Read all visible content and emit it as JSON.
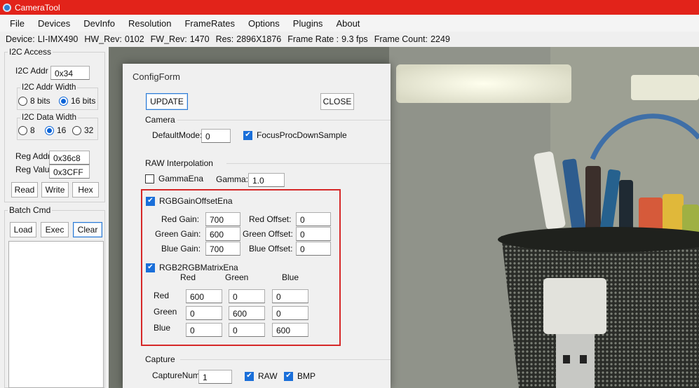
{
  "window": {
    "title": "CameraTool"
  },
  "menu": [
    "File",
    "Devices",
    "DevInfo",
    "Resolution",
    "FrameRates",
    "Options",
    "Plugins",
    "About"
  ],
  "device_info": {
    "device_label": "Device:",
    "device": "LI-IMX490",
    "hw_label": "HW_Rev:",
    "hw": "0102",
    "fw_label": "FW_Rev:",
    "fw": "1470",
    "res_label": "Res:",
    "res": "2896X1876",
    "fps_label": "Frame Rate :",
    "fps": "9.3 fps",
    "count_label": "Frame Count:",
    "count": "2249"
  },
  "i2c": {
    "group_label": "I2C Access",
    "addr_label": "I2C Addr",
    "addr_value": "0x34",
    "addr_width": {
      "label": "I2C Addr Width",
      "opt_8": "8 bits",
      "opt_16": "16 bits",
      "selected": "16 bits"
    },
    "data_width": {
      "label": "I2C Data Width",
      "opt_8": "8",
      "opt_16": "16",
      "opt_32": "32",
      "selected": "16"
    },
    "reg_addr_label": "Reg Addr",
    "reg_addr_value": "0x36c8",
    "reg_value_label": "Reg Value",
    "reg_value_value": "0x3CFF",
    "read_btn": "Read",
    "write_btn": "Write",
    "hex_btn": "Hex"
  },
  "batch": {
    "label": "Batch Cmd",
    "load_btn": "Load",
    "exec_btn": "Exec",
    "clear_btn": "Clear"
  },
  "config": {
    "title": "ConfigForm",
    "update_btn": "UPDATE",
    "close_btn": "CLOSE",
    "camera": {
      "label": "Camera",
      "default_mode_label": "DefaultMode:",
      "default_mode_value": "0",
      "focus_label": "FocusProcDownSample",
      "focus_checked": true
    },
    "raw": {
      "label": "RAW Interpolation",
      "gamma_ena_label": "GammaEna",
      "gamma_ena_checked": false,
      "gamma_label": "Gamma:",
      "gamma_value": "1.0",
      "gain_offset_label": "RGBGainOffsetEna",
      "gain_offset_checked": true,
      "red_gain_label": "Red Gain:",
      "red_gain": "700",
      "red_offset_label": "Red Offset:",
      "red_offset": "0",
      "green_gain_label": "Green Gain:",
      "green_gain": "600",
      "green_offset_label": "Green Offset:",
      "green_offset": "0",
      "blue_gain_label": "Blue Gain:",
      "blue_gain": "700",
      "blue_offset_label": "Blue Offset:",
      "blue_offset": "0",
      "matrix_label": "RGB2RGBMatrixEna",
      "matrix_checked": true,
      "matrix_cols": [
        "Red",
        "Green",
        "Blue"
      ],
      "matrix_rows": [
        {
          "label": "Red",
          "values": [
            "600",
            "0",
            "0"
          ]
        },
        {
          "label": "Green",
          "values": [
            "0",
            "600",
            "0"
          ]
        },
        {
          "label": "Blue",
          "values": [
            "0",
            "0",
            "600"
          ]
        }
      ]
    },
    "capture": {
      "label": "Capture",
      "num_label": "CaptureNum:",
      "num_value": "1",
      "raw_label": "RAW",
      "raw_checked": true,
      "bmp_label": "BMP",
      "bmp_checked": true
    }
  },
  "colors": {
    "titlebar": "#e2231a",
    "accent": "#1a6fd9",
    "highlight_box": "#d62828"
  }
}
